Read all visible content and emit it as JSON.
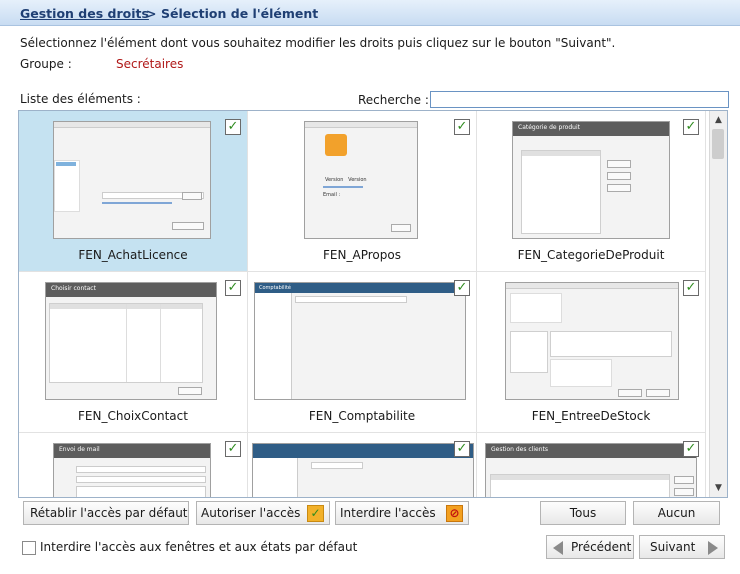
{
  "breadcrumb": {
    "parent": "Gestion des droits",
    "separator": ">",
    "current": "Sélection de l'élément"
  },
  "intro_text": "Sélectionnez l'élément dont vous souhaitez modifier les droits puis cliquez sur le bouton \"Suivant\".",
  "group": {
    "label": "Groupe :",
    "value": "Secrétaires"
  },
  "list_label": "Liste des éléments :",
  "search": {
    "label": "Recherche :",
    "value": ""
  },
  "elements": [
    {
      "name": "FEN_AchatLicence",
      "checked": true,
      "selected": true
    },
    {
      "name": "FEN_APropos",
      "checked": true,
      "selected": false
    },
    {
      "name": "FEN_CategorieDeProduit",
      "checked": true,
      "selected": false
    },
    {
      "name": "FEN_ChoixContact",
      "checked": true,
      "selected": false
    },
    {
      "name": "FEN_Comptabilite",
      "checked": true,
      "selected": false
    },
    {
      "name": "FEN_EntreeDeStock",
      "checked": true,
      "selected": false
    },
    {
      "name": "",
      "checked": true,
      "selected": false
    },
    {
      "name": "",
      "checked": true,
      "selected": false
    },
    {
      "name": "",
      "checked": true,
      "selected": false
    }
  ],
  "thumb_texts": {
    "apropos_version": "Version",
    "apropos_version2": "Version",
    "apropos_email": "Email :",
    "categorie_title": "Catégorie de produit",
    "choix_title": "Choisir contact",
    "compta_title": "Comptabilité",
    "mail_title": "Envoi de mail",
    "clients_title": "Gestion des clients"
  },
  "buttons": {
    "reset_default": "Rétablir l'accès par défaut",
    "allow_access": "Autoriser l'accès",
    "deny_access": "Interdire l'accès",
    "all": "Tous",
    "none": "Aucun",
    "previous": "Précédent",
    "next": "Suivant"
  },
  "default_deny": {
    "label": "Interdire l'accès aux fenêtres et aux états par défaut",
    "checked": false
  },
  "colors": {
    "group_value": "#b01818",
    "selected_cell": "#c5e2f1",
    "check_mark": "#2e8b1e",
    "title_text": "#1f3f73"
  }
}
